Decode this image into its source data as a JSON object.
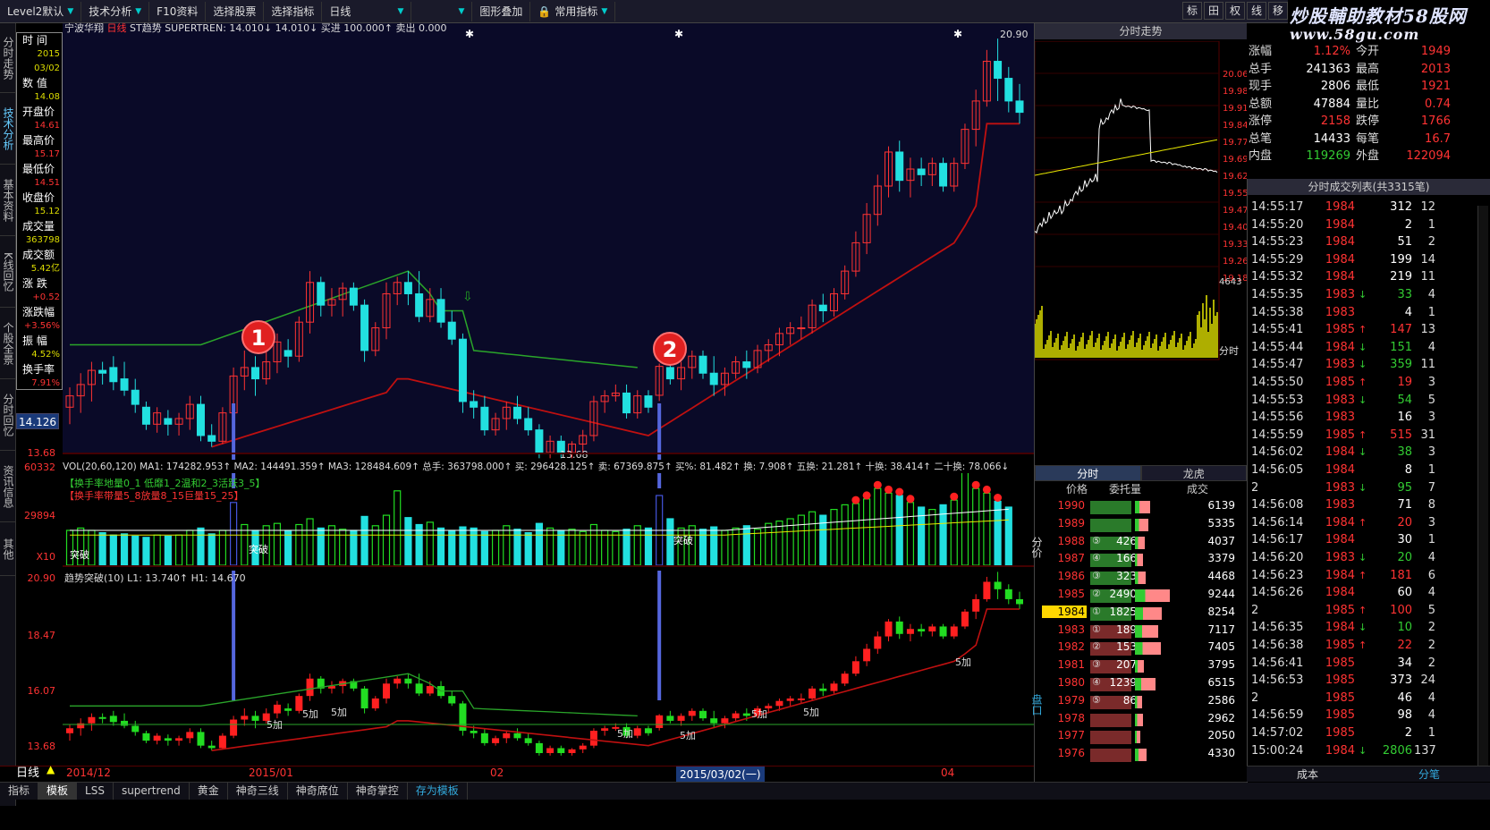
{
  "toolbar": {
    "items": [
      "Level2默认",
      "技术分析",
      "F10资料",
      "选择股票",
      "选择指标",
      "日线",
      "",
      "图形叠加",
      "常用指标"
    ],
    "right_icons": [
      "标",
      "田",
      "权",
      "线",
      "移"
    ]
  },
  "watermark": {
    "line1": "炒股輔助教材58股网",
    "line2": "www.58gu.com"
  },
  "left_tabs": [
    "分时走势",
    "技术分析",
    "基本资料",
    "K线回忆",
    "个股全景",
    "分时回忆",
    "资讯信息",
    "其他"
  ],
  "info_box": {
    "rows": [
      {
        "label": "时  间",
        "value": "2015"
      },
      {
        "label": "",
        "value": "03/02"
      },
      {
        "label": "数  值",
        "value": "14.08"
      },
      {
        "label": "开盘价",
        "value": "14.61"
      },
      {
        "label": "最高价",
        "value": "15.17"
      },
      {
        "label": "最低价",
        "value": "14.51"
      },
      {
        "label": "收盘价",
        "value": "15.12"
      },
      {
        "label": "成交量",
        "value": "363798"
      },
      {
        "label": "成交额",
        "value": "5.42亿"
      },
      {
        "label": "涨  跌",
        "value": "+0.52"
      },
      {
        "label": "涨跌幅",
        "value": "+3.56%"
      },
      {
        "label": "振  幅",
        "value": "4.52%"
      },
      {
        "label": "换手率",
        "value": "7.91%"
      }
    ]
  },
  "price_axis": {
    "current": "14.126",
    "bottom": "13.68",
    "low_label": "13.68"
  },
  "main_chart": {
    "header_name": "宁波华翔",
    "header_period": "日线",
    "header_indicator": "ST趋势 SUPERTREN: 14.010↓ 14.010↓ 买进 100.000↑ 卖出 0.000",
    "top_right_high": "20.90",
    "bottom_low": "13.68",
    "badge1": "1",
    "badge2": "2"
  },
  "volume_panel": {
    "header": "VOL(20,60,120) MA1: 174282.953↑ MA2: 144491.359↑ MA3: 128484.609↑ 总手: 363798.000↑ 买: 296428.125↑ 卖: 67369.875↑ 买%: 81.482↑ 换: 7.908↑ 五换: 21.281↑ 十换: 38.414↑ 二十换: 78.066↓",
    "legend1": "【换手率地量0_1 低靡1_2温和2_3活跃3_5】",
    "legend2": "【换手率带量5_8放量8_15巨量15_25】",
    "y_top": "60332",
    "y_mid": "29894",
    "y_unit": "X10",
    "labels": [
      "突破",
      "突破",
      "突破"
    ]
  },
  "trend_panel": {
    "header": "趋势突破(10) L1: 13.740↑ H1: 14.670",
    "y_labels": [
      "20.90",
      "18.47",
      "16.07",
      "13.68"
    ],
    "add_labels": [
      "5加",
      "5加",
      "5加",
      "5加",
      "5加",
      "5加",
      "5加",
      "5加"
    ]
  },
  "date_axis": {
    "labels": [
      "2014/12",
      "2015/01",
      "02",
      "2015/03/02(一)",
      "04"
    ],
    "period": "日线"
  },
  "bottom_tabs": [
    "指标",
    "模板",
    "LSS",
    "supertrend",
    "黄金",
    "神奇三线",
    "神奇席位",
    "神奇掌控",
    "存为模板"
  ],
  "minute_chart": {
    "title": "分时走势",
    "y_labels": [
      "20.06",
      "19.98",
      "19.91",
      "19.84",
      "19.77",
      "19.69",
      "19.62",
      "19.55",
      "19.47",
      "19.40",
      "19.33",
      "19.26",
      "19.18"
    ],
    "vol_label": "4643",
    "side_label": "分时"
  },
  "quote": {
    "rows": [
      {
        "k": "涨幅",
        "v": "1.12%",
        "k2": "今开",
        "v2": "1949"
      },
      {
        "k": "总手",
        "v": "241363",
        "k2": "最高",
        "v2": "2013"
      },
      {
        "k": "现手",
        "v": "2806",
        "k2": "最低",
        "v2": "1921"
      },
      {
        "k": "总额",
        "v": "47884",
        "k2": "量比",
        "v2": "0.74"
      },
      {
        "k": "涨停",
        "v": "2158",
        "k2": "跌停",
        "v2": "1766"
      },
      {
        "k": "总笔",
        "v": "14433",
        "k2": "每笔",
        "v2": "16.7"
      },
      {
        "k": "内盘",
        "v": "119269",
        "k2": "外盘",
        "v2": "122094"
      }
    ]
  },
  "ticks": {
    "title": "分时成交列表(共3315笔)",
    "rows": [
      {
        "t": "14:55:17",
        "p": "1984",
        "a": "",
        "v": "312",
        "n": "12"
      },
      {
        "t": "14:55:20",
        "p": "1984",
        "a": "",
        "v": "2",
        "n": "1"
      },
      {
        "t": "14:55:23",
        "p": "1984",
        "a": "",
        "v": "51",
        "n": "2"
      },
      {
        "t": "14:55:29",
        "p": "1984",
        "a": "",
        "v": "199",
        "n": "14"
      },
      {
        "t": "14:55:32",
        "p": "1984",
        "a": "",
        "v": "219",
        "n": "11"
      },
      {
        "t": "14:55:35",
        "p": "1983",
        "a": "↓",
        "v": "33",
        "n": "4"
      },
      {
        "t": "14:55:38",
        "p": "1983",
        "a": "",
        "v": "4",
        "n": "1"
      },
      {
        "t": "14:55:41",
        "p": "1985",
        "a": "↑",
        "v": "147",
        "n": "13"
      },
      {
        "t": "14:55:44",
        "p": "1984",
        "a": "↓",
        "v": "151",
        "n": "4"
      },
      {
        "t": "14:55:47",
        "p": "1983",
        "a": "↓",
        "v": "359",
        "n": "11"
      },
      {
        "t": "14:55:50",
        "p": "1985",
        "a": "↑",
        "v": "19",
        "n": "3"
      },
      {
        "t": "14:55:53",
        "p": "1983",
        "a": "↓",
        "v": "54",
        "n": "5"
      },
      {
        "t": "14:55:56",
        "p": "1983",
        "a": "",
        "v": "16",
        "n": "3"
      },
      {
        "t": "14:55:59",
        "p": "1985",
        "a": "↑",
        "v": "515",
        "n": "31"
      },
      {
        "t": "14:56:02",
        "p": "1984",
        "a": "↓",
        "v": "38",
        "n": "3"
      },
      {
        "t": "14:56:05",
        "p": "1984",
        "a": "",
        "v": "8",
        "n": "1"
      },
      {
        "t": "2",
        "p": "1983",
        "a": "↓",
        "v": "95",
        "n": "7"
      },
      {
        "t": "14:56:08",
        "p": "1983",
        "a": "",
        "v": "71",
        "n": "8"
      },
      {
        "t": "14:56:14",
        "p": "1984",
        "a": "↑",
        "v": "20",
        "n": "3"
      },
      {
        "t": "14:56:17",
        "p": "1984",
        "a": "",
        "v": "30",
        "n": "1"
      },
      {
        "t": "14:56:20",
        "p": "1983",
        "a": "↓",
        "v": "20",
        "n": "4"
      },
      {
        "t": "14:56:23",
        "p": "1984",
        "a": "↑",
        "v": "181",
        "n": "6"
      },
      {
        "t": "14:56:26",
        "p": "1984",
        "a": "",
        "v": "60",
        "n": "4"
      },
      {
        "t": "2",
        "p": "1985",
        "a": "↑",
        "v": "100",
        "n": "5"
      },
      {
        "t": "14:56:35",
        "p": "1984",
        "a": "↓",
        "v": "10",
        "n": "2"
      },
      {
        "t": "14:56:38",
        "p": "1985",
        "a": "↑",
        "v": "22",
        "n": "2"
      },
      {
        "t": "14:56:41",
        "p": "1985",
        "a": "",
        "v": "34",
        "n": "2"
      },
      {
        "t": "14:56:53",
        "p": "1985",
        "a": "",
        "v": "373",
        "n": "24"
      },
      {
        "t": "2",
        "p": "1985",
        "a": "",
        "v": "46",
        "n": "4"
      },
      {
        "t": "14:56:59",
        "p": "1985",
        "a": "",
        "v": "98",
        "n": "4"
      },
      {
        "t": "14:57:02",
        "p": "1985",
        "a": "",
        "v": "2",
        "n": "1"
      },
      {
        "t": "15:00:24",
        "p": "1984",
        "a": "↓",
        "v": "2806",
        "n": "137"
      }
    ],
    "bottom_tabs": [
      "成本",
      "分笔"
    ]
  },
  "order_book": {
    "tabs": [
      "分时",
      "龙虎"
    ],
    "headers": [
      "价格",
      "委托量",
      "成交"
    ],
    "side_labels": [
      "分价",
      "盘口"
    ],
    "rows": [
      {
        "p": "1990",
        "rank": "",
        "amt": "",
        "trd": "6139",
        "vol": 0.46,
        "sv": 0.33
      },
      {
        "p": "1989",
        "rank": "",
        "amt": "",
        "trd": "5335",
        "vol": 0.46,
        "sv": 0.28
      },
      {
        "p": "1988",
        "rank": "⑤",
        "amt": "426",
        "trd": "4037",
        "vol": 0.46,
        "sv": 0.21
      },
      {
        "p": "1987",
        "rank": "④",
        "amt": "166",
        "trd": "3379",
        "vol": 0.46,
        "sv": 0.17
      },
      {
        "p": "1986",
        "rank": "③",
        "amt": "323",
        "trd": "4468",
        "vol": 0.46,
        "sv": 0.24
      },
      {
        "p": "1985",
        "rank": "②",
        "amt": "2490",
        "trd": "9244",
        "vol": 0.46,
        "sv": 0.75
      },
      {
        "p": "1984",
        "rank": "①",
        "amt": "1825",
        "trd": "8254",
        "vol": 0.46,
        "sv": 0.58
      },
      {
        "p": "1983",
        "rank": "①",
        "amt": "189",
        "trd": "7117",
        "vol": 0.46,
        "sv": 0.5
      },
      {
        "p": "1982",
        "rank": "②",
        "amt": "153",
        "trd": "7405",
        "vol": 0.46,
        "sv": 0.55
      },
      {
        "p": "1981",
        "rank": "③",
        "amt": "207",
        "trd": "3795",
        "vol": 0.46,
        "sv": 0.2
      },
      {
        "p": "1980",
        "rank": "④",
        "amt": "1239",
        "trd": "6515",
        "vol": 0.46,
        "sv": 0.45
      },
      {
        "p": "1979",
        "rank": "⑤",
        "amt": "86",
        "trd": "2586",
        "vol": 0.46,
        "sv": 0.15
      },
      {
        "p": "1978",
        "rank": "",
        "amt": "",
        "trd": "2962",
        "vol": 0.46,
        "sv": 0.18
      },
      {
        "p": "1977",
        "rank": "",
        "amt": "",
        "trd": "2050",
        "vol": 0.46,
        "sv": 0.12
      },
      {
        "p": "1976",
        "rank": "",
        "amt": "",
        "trd": "4330",
        "vol": 0.46,
        "sv": 0.25
      }
    ]
  },
  "colors": {
    "up": "#ff3333",
    "down": "#22e0e0",
    "ma_green": "#22aa22",
    "st_red": "#cc1111",
    "bg_chart": "#0a0a28",
    "volume_yellow": "#e8e800",
    "bar_blue": "#4455dd"
  },
  "candles": [
    {
      "o": 14.4,
      "h": 14.75,
      "l": 14.1,
      "c": 14.6
    },
    {
      "o": 14.6,
      "h": 15.0,
      "l": 14.3,
      "c": 14.8
    },
    {
      "o": 14.8,
      "h": 15.2,
      "l": 14.5,
      "c": 15.05
    },
    {
      "o": 15.05,
      "h": 15.2,
      "l": 14.8,
      "c": 15.0
    },
    {
      "o": 15.1,
      "h": 15.3,
      "l": 14.7,
      "c": 14.85
    },
    {
      "o": 14.9,
      "h": 15.2,
      "l": 14.6,
      "c": 14.7
    },
    {
      "o": 14.7,
      "h": 14.9,
      "l": 14.3,
      "c": 14.45
    },
    {
      "o": 14.4,
      "h": 14.5,
      "l": 14.0,
      "c": 14.1
    },
    {
      "o": 14.1,
      "h": 14.4,
      "l": 13.95,
      "c": 14.3
    },
    {
      "o": 14.2,
      "h": 14.35,
      "l": 13.9,
      "c": 14.1
    },
    {
      "o": 14.1,
      "h": 14.3,
      "l": 13.9,
      "c": 14.2
    },
    {
      "o": 14.2,
      "h": 14.6,
      "l": 14.0,
      "c": 14.45
    },
    {
      "o": 14.45,
      "h": 14.6,
      "l": 13.8,
      "c": 13.9
    },
    {
      "o": 13.9,
      "h": 14.1,
      "l": 13.7,
      "c": 13.8
    },
    {
      "o": 13.8,
      "h": 14.4,
      "l": 13.75,
      "c": 14.3
    },
    {
      "o": 14.3,
      "h": 15.1,
      "l": 14.2,
      "c": 14.95
    },
    {
      "o": 14.95,
      "h": 15.4,
      "l": 14.7,
      "c": 15.1
    },
    {
      "o": 15.1,
      "h": 15.3,
      "l": 14.6,
      "c": 14.9
    },
    {
      "o": 14.9,
      "h": 15.4,
      "l": 14.8,
      "c": 15.2
    },
    {
      "o": 15.2,
      "h": 15.7,
      "l": 15.0,
      "c": 15.55
    },
    {
      "o": 15.4,
      "h": 15.6,
      "l": 15.1,
      "c": 15.3
    },
    {
      "o": 15.3,
      "h": 16.0,
      "l": 15.2,
      "c": 15.9
    },
    {
      "o": 15.9,
      "h": 16.8,
      "l": 15.7,
      "c": 16.6
    },
    {
      "o": 16.6,
      "h": 16.7,
      "l": 16.0,
      "c": 16.2
    },
    {
      "o": 16.2,
      "h": 16.5,
      "l": 16.0,
      "c": 16.3
    },
    {
      "o": 16.3,
      "h": 16.6,
      "l": 16.0,
      "c": 16.5
    },
    {
      "o": 16.5,
      "h": 16.6,
      "l": 16.1,
      "c": 16.2
    },
    {
      "o": 16.2,
      "h": 16.3,
      "l": 15.2,
      "c": 15.4
    },
    {
      "o": 15.4,
      "h": 15.9,
      "l": 15.3,
      "c": 15.8
    },
    {
      "o": 15.8,
      "h": 16.6,
      "l": 15.6,
      "c": 16.4
    },
    {
      "o": 16.4,
      "h": 16.7,
      "l": 16.2,
      "c": 16.6
    },
    {
      "o": 16.6,
      "h": 16.8,
      "l": 16.2,
      "c": 16.4
    },
    {
      "o": 16.4,
      "h": 16.8,
      "l": 15.9,
      "c": 16.0
    },
    {
      "o": 16.0,
      "h": 16.5,
      "l": 15.9,
      "c": 16.3
    },
    {
      "o": 16.3,
      "h": 16.5,
      "l": 15.8,
      "c": 15.9
    },
    {
      "o": 15.9,
      "h": 16.1,
      "l": 15.5,
      "c": 15.6
    },
    {
      "o": 15.6,
      "h": 15.7,
      "l": 14.3,
      "c": 14.5
    },
    {
      "o": 14.5,
      "h": 14.7,
      "l": 14.2,
      "c": 14.4
    },
    {
      "o": 14.4,
      "h": 14.6,
      "l": 13.9,
      "c": 14.0
    },
    {
      "o": 14.0,
      "h": 14.3,
      "l": 13.9,
      "c": 14.2
    },
    {
      "o": 14.2,
      "h": 14.5,
      "l": 14.0,
      "c": 14.4
    },
    {
      "o": 14.4,
      "h": 14.6,
      "l": 14.1,
      "c": 14.2
    },
    {
      "o": 14.2,
      "h": 14.4,
      "l": 13.9,
      "c": 14.0
    },
    {
      "o": 14.0,
      "h": 14.1,
      "l": 13.5,
      "c": 13.6
    },
    {
      "o": 13.6,
      "h": 13.9,
      "l": 13.5,
      "c": 13.8
    },
    {
      "o": 13.8,
      "h": 13.9,
      "l": 13.5,
      "c": 13.6
    },
    {
      "o": 13.6,
      "h": 13.8,
      "l": 13.5,
      "c": 13.75
    },
    {
      "o": 13.75,
      "h": 14.0,
      "l": 13.6,
      "c": 13.9
    },
    {
      "o": 13.9,
      "h": 14.6,
      "l": 13.8,
      "c": 14.5
    },
    {
      "o": 14.5,
      "h": 14.7,
      "l": 14.3,
      "c": 14.6
    },
    {
      "o": 14.6,
      "h": 14.8,
      "l": 14.5,
      "c": 14.65
    },
    {
      "o": 14.65,
      "h": 14.8,
      "l": 14.2,
      "c": 14.3
    },
    {
      "o": 14.3,
      "h": 14.7,
      "l": 14.2,
      "c": 14.6
    },
    {
      "o": 14.6,
      "h": 14.7,
      "l": 14.3,
      "c": 14.4
    },
    {
      "o": 14.61,
      "h": 15.17,
      "l": 14.51,
      "c": 15.12
    },
    {
      "o": 15.1,
      "h": 15.3,
      "l": 14.8,
      "c": 14.9
    },
    {
      "o": 14.9,
      "h": 15.2,
      "l": 14.7,
      "c": 15.1
    },
    {
      "o": 15.1,
      "h": 15.4,
      "l": 14.9,
      "c": 15.3
    },
    {
      "o": 15.3,
      "h": 15.4,
      "l": 14.9,
      "c": 15.0
    },
    {
      "o": 15.0,
      "h": 15.3,
      "l": 14.6,
      "c": 14.8
    },
    {
      "o": 14.8,
      "h": 15.1,
      "l": 14.6,
      "c": 15.0
    },
    {
      "o": 15.0,
      "h": 15.3,
      "l": 14.9,
      "c": 15.2
    },
    {
      "o": 15.2,
      "h": 15.4,
      "l": 14.9,
      "c": 15.1
    },
    {
      "o": 15.1,
      "h": 15.5,
      "l": 15.0,
      "c": 15.4
    },
    {
      "o": 15.4,
      "h": 15.6,
      "l": 15.2,
      "c": 15.5
    },
    {
      "o": 15.5,
      "h": 15.8,
      "l": 15.3,
      "c": 15.7
    },
    {
      "o": 15.7,
      "h": 15.9,
      "l": 15.5,
      "c": 15.8
    },
    {
      "o": 15.8,
      "h": 16.0,
      "l": 15.6,
      "c": 15.8
    },
    {
      "o": 15.8,
      "h": 16.3,
      "l": 15.7,
      "c": 16.2
    },
    {
      "o": 16.2,
      "h": 16.4,
      "l": 15.9,
      "c": 16.1
    },
    {
      "o": 16.1,
      "h": 16.5,
      "l": 16.0,
      "c": 16.4
    },
    {
      "o": 16.4,
      "h": 16.9,
      "l": 16.3,
      "c": 16.8
    },
    {
      "o": 16.8,
      "h": 17.5,
      "l": 16.7,
      "c": 17.3
    },
    {
      "o": 17.3,
      "h": 18.0,
      "l": 17.1,
      "c": 17.8
    },
    {
      "o": 17.8,
      "h": 18.5,
      "l": 17.6,
      "c": 18.3
    },
    {
      "o": 18.3,
      "h": 19.0,
      "l": 18.1,
      "c": 18.9
    },
    {
      "o": 18.9,
      "h": 19.1,
      "l": 18.2,
      "c": 18.4
    },
    {
      "o": 18.4,
      "h": 18.8,
      "l": 18.1,
      "c": 18.6
    },
    {
      "o": 18.6,
      "h": 18.8,
      "l": 18.3,
      "c": 18.5
    },
    {
      "o": 18.5,
      "h": 18.8,
      "l": 18.3,
      "c": 18.7
    },
    {
      "o": 18.7,
      "h": 18.8,
      "l": 18.2,
      "c": 18.3
    },
    {
      "o": 18.3,
      "h": 18.8,
      "l": 18.2,
      "c": 18.7
    },
    {
      "o": 18.7,
      "h": 19.4,
      "l": 18.6,
      "c": 19.3
    },
    {
      "o": 19.3,
      "h": 20.0,
      "l": 19.0,
      "c": 19.8
    },
    {
      "o": 19.8,
      "h": 20.7,
      "l": 19.7,
      "c": 20.5
    },
    {
      "o": 20.5,
      "h": 20.9,
      "l": 19.8,
      "c": 20.2
    },
    {
      "o": 20.2,
      "h": 20.4,
      "l": 19.6,
      "c": 19.8
    },
    {
      "o": 19.8,
      "h": 20.1,
      "l": 19.4,
      "c": 19.6
    }
  ]
}
